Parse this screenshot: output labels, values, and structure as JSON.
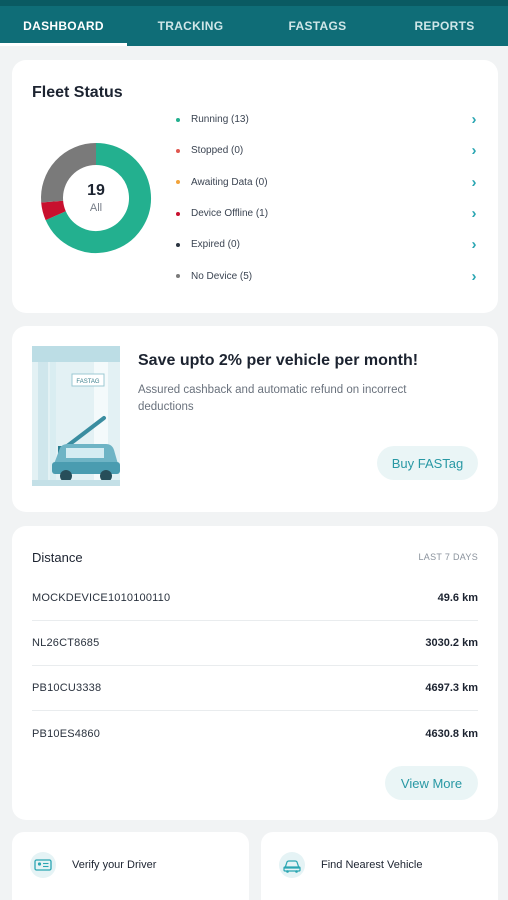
{
  "tabs": [
    {
      "label": "DASHBOARD",
      "active": true
    },
    {
      "label": "TRACKING",
      "active": false
    },
    {
      "label": "FASTAGS",
      "active": false
    },
    {
      "label": "REPORTS",
      "active": false
    }
  ],
  "fleet_status": {
    "title": "Fleet Status",
    "total": "19",
    "total_label": "All",
    "items": [
      {
        "label": "Running (13)",
        "count": 13,
        "color": "#23b08f"
      },
      {
        "label": "Stopped (0)",
        "count": 0,
        "color": "#e0574f"
      },
      {
        "label": "Awaiting Data (0)",
        "count": 0,
        "color": "#f2a33a"
      },
      {
        "label": "Device Offline (1)",
        "count": 1,
        "color": "#c8102e"
      },
      {
        "label": "Expired (0)",
        "count": 0,
        "color": "#2b3440"
      },
      {
        "label": "No Device (5)",
        "count": 5,
        "color": "#7a7a7a"
      }
    ],
    "chevron_icon": "chevron-right-icon"
  },
  "promo": {
    "title": "Save upto 2% per vehicle per month!",
    "description": "Assured cashback and automatic refund on incorrect deductions",
    "button_label": "Buy FASTag",
    "art_sign": "FASTAG"
  },
  "distance": {
    "title": "Distance",
    "period": "LAST 7 DAYS",
    "rows": [
      {
        "vehicle": "MOCKDEVICE1010100110",
        "km": "49.6 km"
      },
      {
        "vehicle": "NL26CT8685",
        "km": "3030.2 km"
      },
      {
        "vehicle": "PB10CU3338",
        "km": "4697.3 km"
      },
      {
        "vehicle": "PB10ES4860",
        "km": "4630.8 km"
      }
    ],
    "view_more_label": "View More"
  },
  "bottom_cards": [
    {
      "label": "Verify your Driver",
      "icon": "id-card-icon"
    },
    {
      "label": "Find Nearest Vehicle",
      "icon": "car-icon"
    }
  ],
  "colors": {
    "primary": "#0f6d77",
    "accent": "#2aa6b2",
    "running": "#23b08f",
    "offline": "#c8102e",
    "no_device": "#7a7a7a"
  }
}
